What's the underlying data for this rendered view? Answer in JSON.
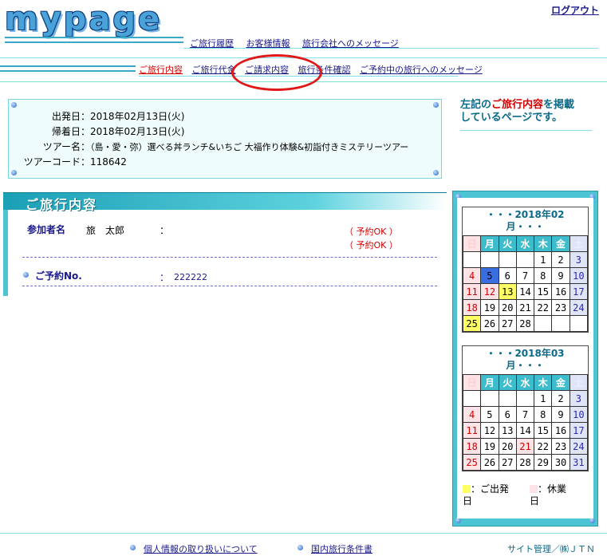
{
  "header": {
    "logo": "mypage",
    "logout": "ログアウト",
    "nav1": [
      "ご旅行履歴",
      "お客様情報",
      "旅行会社へのメッセージ"
    ],
    "nav2": [
      {
        "label": "ご旅行内容",
        "active": true
      },
      {
        "label": "ご旅行代金",
        "active": false
      },
      {
        "label": "ご請求内容",
        "active": false
      },
      {
        "label": "旅行条件確認",
        "active": false
      },
      {
        "label": "ご予約中の旅行へのメッセージ",
        "active": false
      }
    ]
  },
  "summary": {
    "departure_label": "出発日",
    "departure_value": "2018年02月13日(火)",
    "return_label": "帰着日",
    "return_value": "2018年02月13日(火)",
    "tour_name_label": "ツアー名",
    "tour_name_value": "（島・愛・弥）選べる丼ランチ&いちご 大福作り体験&初詣付きミステリーツアー",
    "tour_code_label": "ツアーコード",
    "tour_code_value": "118642",
    "separator": "："
  },
  "note": {
    "line1_pre": "左記の",
    "line1_highlight": "ご旅行内容",
    "line1_post": "を掲載",
    "line2": "しているページです。"
  },
  "tour": {
    "heading": "ご旅行内容",
    "participants_label": "参加者名",
    "participant_name": "旅　太郎",
    "colon": "：",
    "status1": "（ 予約OK ）",
    "status2": "（ 予約OK ）",
    "reservation_label": "ご予約No.",
    "reservation_colon": "：",
    "reservation_value": "222222"
  },
  "calendar": {
    "weekdays": [
      "日",
      "月",
      "火",
      "水",
      "木",
      "金",
      "土"
    ],
    "months": [
      {
        "title_line1": "・・・2018年02",
        "title_line2": "月・・・",
        "weeks": [
          [
            "",
            "",
            "",
            "",
            "1",
            "2",
            "3"
          ],
          [
            "4",
            "5",
            "6",
            "7",
            "8",
            "9",
            "10"
          ],
          [
            "11",
            "12",
            "13",
            "14",
            "15",
            "16",
            "17"
          ],
          [
            "18",
            "19",
            "20",
            "21",
            "22",
            "23",
            "24"
          ],
          [
            "25",
            "26",
            "27",
            "28",
            "",
            "",
            ""
          ]
        ],
        "holidays": [
          "11",
          "12"
        ],
        "departure_days": [
          "13",
          "25"
        ],
        "today": [
          "5"
        ]
      },
      {
        "title_line1": "・・・2018年03",
        "title_line2": "月・・・",
        "weeks": [
          [
            "",
            "",
            "",
            "",
            "1",
            "2",
            "3"
          ],
          [
            "4",
            "5",
            "6",
            "7",
            "8",
            "9",
            "10"
          ],
          [
            "11",
            "12",
            "13",
            "14",
            "15",
            "16",
            "17"
          ],
          [
            "18",
            "19",
            "20",
            "21",
            "22",
            "23",
            "24"
          ],
          [
            "25",
            "26",
            "27",
            "28",
            "29",
            "30",
            "31"
          ]
        ],
        "holidays": [
          "21"
        ],
        "departure_days": [],
        "today": []
      }
    ],
    "legend": {
      "departure": "：ご出発",
      "departure_wrap": "日",
      "closed": "：休業",
      "closed_wrap": "日"
    },
    "colors": {
      "departure": "#ffff66",
      "closed": "#fde2e6"
    }
  },
  "footer": {
    "privacy": "個人情報の取り扱いについて",
    "terms": "国内旅行条件書",
    "admin": "サイト管理／㈱ＪＴＮ"
  }
}
